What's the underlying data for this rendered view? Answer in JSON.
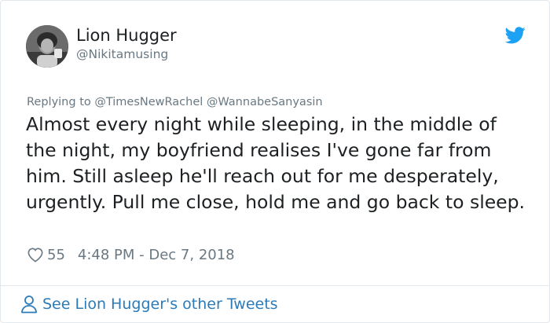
{
  "user": {
    "name": "Lion Hugger",
    "handle": "@Nikitamusing",
    "avatar_icon": "profile-photo"
  },
  "reply": {
    "prefix": "Replying to",
    "mentions": [
      "@TimesNewRachel",
      "@WannabeSanyasin"
    ]
  },
  "tweet": {
    "text": "Almost every night while sleeping, in the middle of the night, my boyfriend realises I've gone far from him. Still asleep he'll reach out for me desperately, urgently. Pull me close, hold me and go back to sleep."
  },
  "meta": {
    "like_icon": "heart-icon",
    "likes": "55",
    "timestamp": "4:48 PM - Dec 7, 2018"
  },
  "footer": {
    "icon": "person-icon",
    "link_text": "See Lion Hugger's other Tweets"
  },
  "colors": {
    "twitter_blue": "#1da1f2",
    "link_blue": "#2b7bb9",
    "secondary_text": "#697882",
    "border": "#e1e8ed"
  }
}
